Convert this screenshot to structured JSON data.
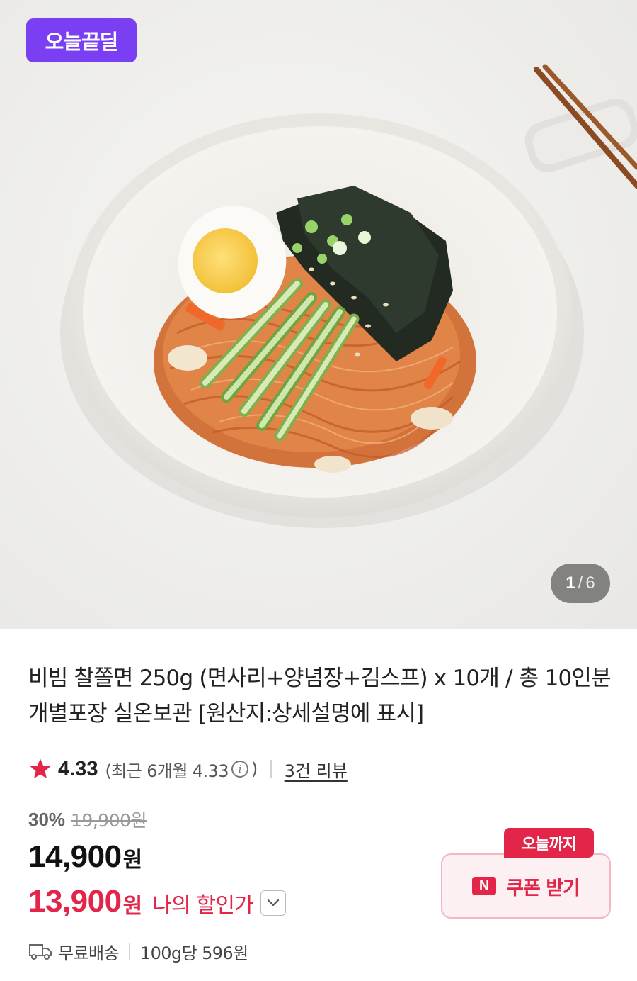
{
  "hero": {
    "deal_badge": "오늘끝딜",
    "pager": {
      "current": "1",
      "separator": "/",
      "total": "6"
    },
    "image_subject": "bibim jjolmyeon noodles in white bowl with egg, cucumber, seaweed and chopsticks"
  },
  "product": {
    "title": "비빔 찰쫄면 250g (면사리+양념장+김스프) x 10개 / 총 10인분 개별포장 실온보관 [원산지:상세설명에 표시]"
  },
  "rating": {
    "score": "4.33",
    "recent_prefix": "(최근 6개월 4.33",
    "info_icon_glyph": "i",
    "recent_suffix": ")",
    "review_link": "3건 리뷰",
    "star_color": "#e4254a"
  },
  "pricing": {
    "discount_rate": "30%",
    "original_price": "19,900원",
    "price": "14,900",
    "price_unit": "원",
    "my_price": "13,900",
    "my_price_unit": "원",
    "my_price_label": "나의 할인가",
    "accent_color": "#e4254a"
  },
  "coupon": {
    "tag": "오늘까지",
    "logo": "N",
    "button_label": "쿠폰 받기"
  },
  "shipping": {
    "free_shipping": "무료배송",
    "unit_price": "100g당 596원"
  },
  "icons": [
    "star-icon",
    "info-icon",
    "chevron-down-icon",
    "naver-n-icon",
    "truck-icon"
  ]
}
